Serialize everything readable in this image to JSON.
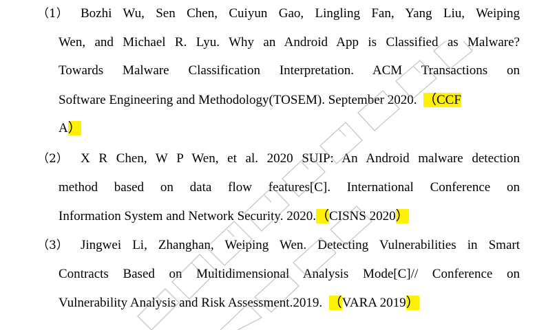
{
  "references": [
    {
      "number": "（1）",
      "lines": [
        "Bozhi Wu, Sen Chen, Cuiyun Gao, Lingling Fan, Yang Liu, Weiping",
        "Wen, and Michael R. Lyu. Why an Android App is Classified as Malware?",
        "Towards Malware Classification Interpretation. ACM Transactions on"
      ],
      "line4_text": "Software Engineering and Methodology(TOSEM). September 2020.",
      "venue_open": "（CCF",
      "line5_text": "A",
      "venue_close": "）"
    },
    {
      "number": "（2）",
      "lines": [
        "X R Chen, W P Wen, et al. 2020 SUIP: An Android malware detection",
        "method based on data flow features[C]. International Conference on"
      ],
      "line3_text": "Information System and Network Security. 2020.",
      "venue_open": "（",
      "venue_text": "CISNS 2020",
      "venue_close": "）"
    },
    {
      "number": "（3）",
      "lines": [
        "Jingwei Li, Zhanghan, Weiping Wen. Detecting Vulnerabilities in Smart",
        "Contracts Based on Multidimensional Analysis Mode[C]// Conference on"
      ],
      "line3_text": "Vulnerability Analysis and Risk Assessment.2019.",
      "venue_open": "（",
      "venue_text": "VARA 2019",
      "venue_close": "）"
    }
  ],
  "highlight_color": "#fff200",
  "watermark_color": "#9e9e9e"
}
